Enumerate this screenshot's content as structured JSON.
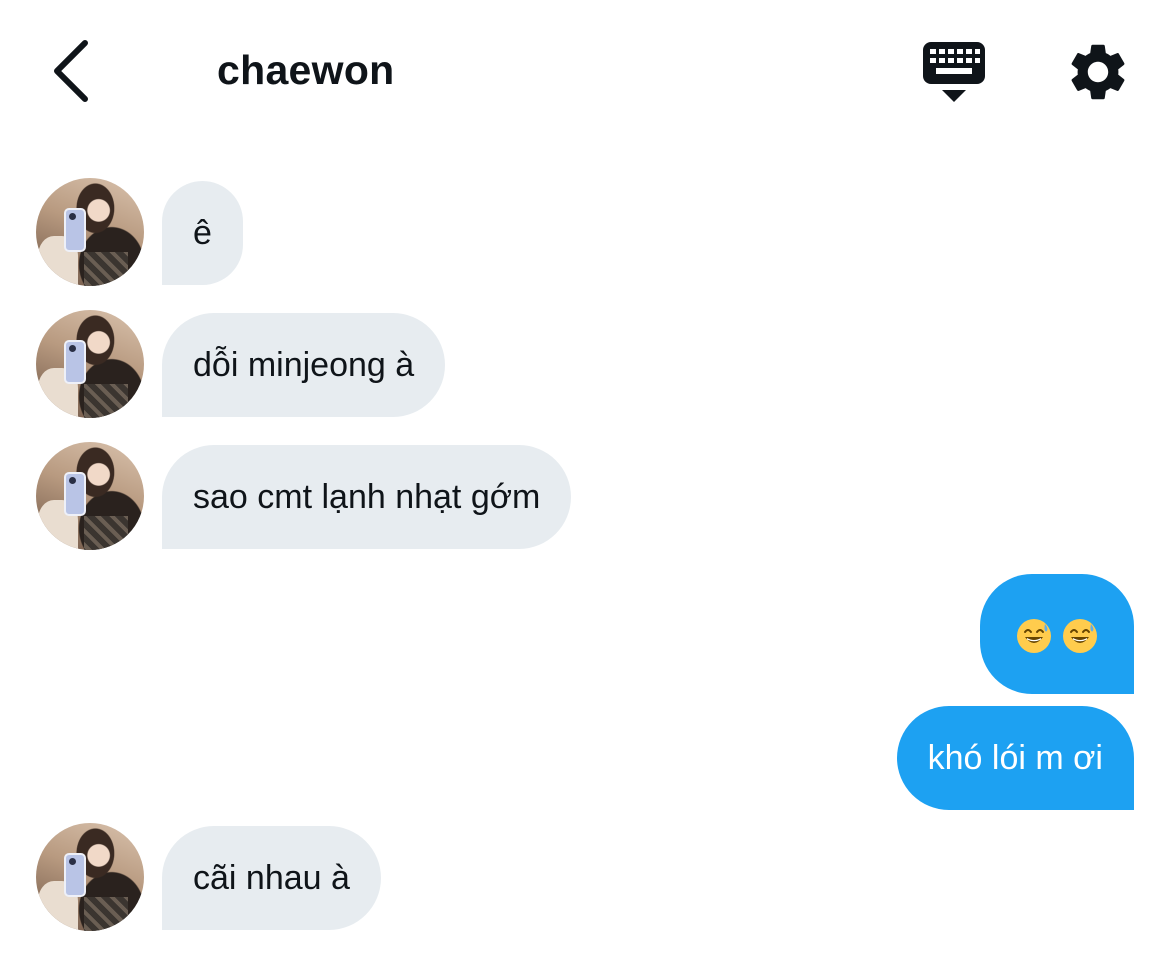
{
  "header": {
    "back_icon": "chevron-left-icon",
    "title": "chaewon",
    "keyboard_icon": "keyboard-icon",
    "settings_icon": "gear-icon"
  },
  "messages": [
    {
      "sender": "them",
      "text": "ê"
    },
    {
      "sender": "them",
      "text": "dỗi minjeong à"
    },
    {
      "sender": "them",
      "text": "sao cmt lạnh nhạt gớm"
    },
    {
      "sender": "me",
      "text": "😅😅",
      "emojis": [
        "grinning-face-with-sweat",
        "grinning-face-with-sweat"
      ]
    },
    {
      "sender": "me",
      "text": "khó lói m ơi"
    },
    {
      "sender": "them",
      "text": "cãi nhau à"
    }
  ],
  "colors": {
    "incoming_bubble": "#e7ecf0",
    "outgoing_bubble": "#1da1f2",
    "text": "#0f1419",
    "outgoing_text": "#ffffff"
  }
}
